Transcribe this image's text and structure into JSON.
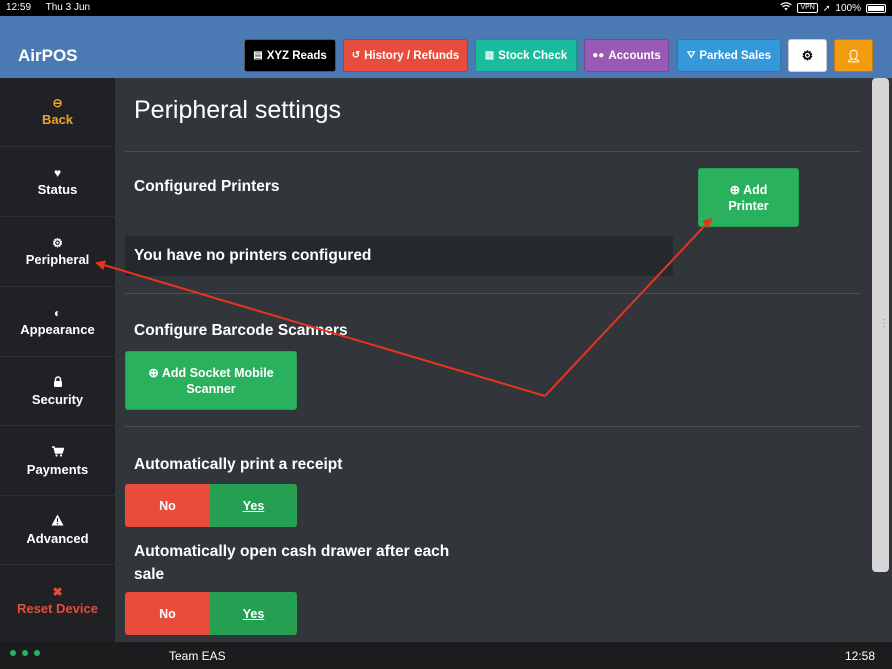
{
  "status_bar": {
    "time": "12:59",
    "date": "Thu 3 Jun",
    "vpn": "VPN",
    "battery": "100%"
  },
  "header": {
    "brand": "AirPOS",
    "buttons": [
      {
        "label": "XYZ Reads",
        "icon": "receipt-icon",
        "color": "#000000"
      },
      {
        "label": "History / Refunds",
        "icon": "history-icon",
        "color": "#e74c3c"
      },
      {
        "label": "Stock Check",
        "icon": "barcode-icon",
        "color": "#1abc9c"
      },
      {
        "label": "Accounts",
        "icon": "users-icon",
        "color": "#9b59b6"
      },
      {
        "label": "Parked Sales",
        "icon": "road-icon",
        "color": "#3498db"
      },
      {
        "label": "",
        "icon": "gear-icon",
        "color": "#ffffff"
      },
      {
        "label": "",
        "icon": "user-icon",
        "color": "#f39c12"
      }
    ]
  },
  "sidebar": {
    "items": [
      {
        "label": "Back",
        "icon": "arrow-left-circle-icon",
        "color": "#f0a030"
      },
      {
        "label": "Status",
        "icon": "heartbeat-icon",
        "color": "#ffffff"
      },
      {
        "label": "Peripheral",
        "icon": "cog-icon",
        "color": "#ffffff"
      },
      {
        "label": "Appearance",
        "icon": "adjust-icon",
        "color": "#ffffff"
      },
      {
        "label": "Security",
        "icon": "lock-icon",
        "color": "#ffffff"
      },
      {
        "label": "Payments",
        "icon": "cart-icon",
        "color": "#ffffff"
      },
      {
        "label": "Advanced",
        "icon": "warning-icon",
        "color": "#ffffff"
      },
      {
        "label": "Reset Device",
        "icon": "close-icon",
        "color": "#e74c3c"
      }
    ]
  },
  "main": {
    "title": "Peripheral settings",
    "printers": {
      "title": "Configured Printers",
      "add_label_line1": "Add",
      "add_label_line2": "Printer",
      "empty_message": "You have no printers configured"
    },
    "scanners": {
      "title": "Configure Barcode Scanners",
      "add_label_line1": "Add Socket Mobile",
      "add_label_line2": "Scanner"
    },
    "auto_print": {
      "title": "Automatically print a receipt",
      "no_label": "No",
      "yes_label": "Yes",
      "selected": "Yes"
    },
    "auto_drawer": {
      "title_line1": "Automatically open cash drawer after each",
      "title_line2": "sale",
      "no_label": "No",
      "yes_label": "Yes",
      "selected": "Yes"
    }
  },
  "footer": {
    "team": "Team EAS",
    "time": "12:58"
  },
  "colors": {
    "header_bg": "#4a79b3",
    "sidebar_bg": "#1f2124",
    "main_bg": "#32363b",
    "green": "#2ab15d",
    "red": "#e74c3c",
    "annotation_arrow": "#e8341c"
  }
}
